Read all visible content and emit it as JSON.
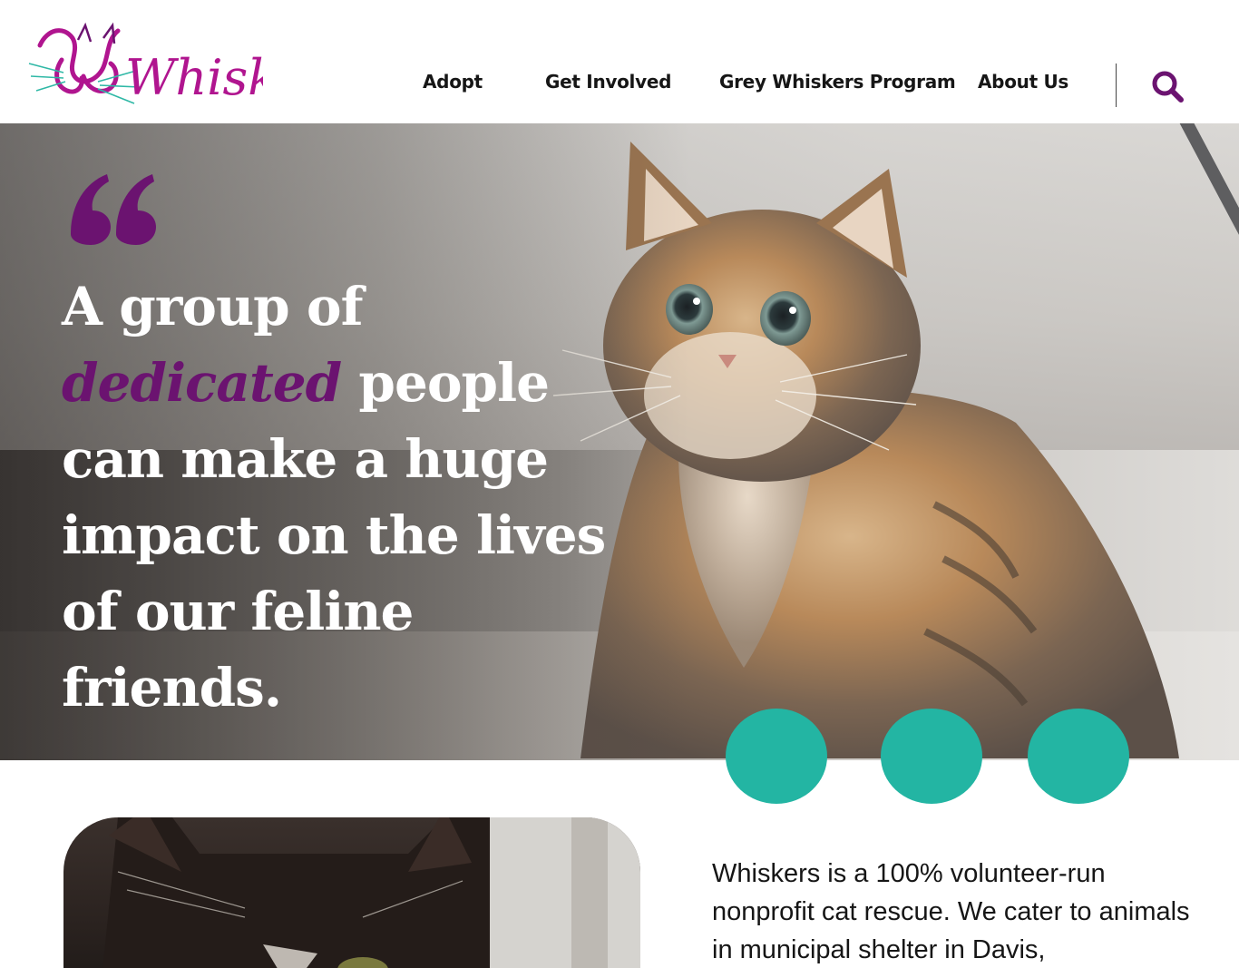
{
  "brand": {
    "logo_text": "Whiskers",
    "accent_purple": "#6b1370",
    "logo_magenta": "#b0158f",
    "teal": "#23b5a3"
  },
  "nav": {
    "items": [
      {
        "label": "Adopt"
      },
      {
        "label": "Get Involved"
      },
      {
        "label": "Grey Whiskers Program"
      },
      {
        "label": "About Us"
      }
    ],
    "search_icon": "search-icon"
  },
  "hero": {
    "quote_part1": "A group of",
    "quote_emphasis": "dedicated",
    "quote_part2": "people can make a huge impact on the lives of our feline friends.",
    "quote_icon": "quote-mark-icon",
    "carousel_dots": 3
  },
  "about": {
    "text": "Whiskers is a 100% volunteer-run nonprofit cat rescue. We cater to animals in municipal shelter in Davis,"
  }
}
